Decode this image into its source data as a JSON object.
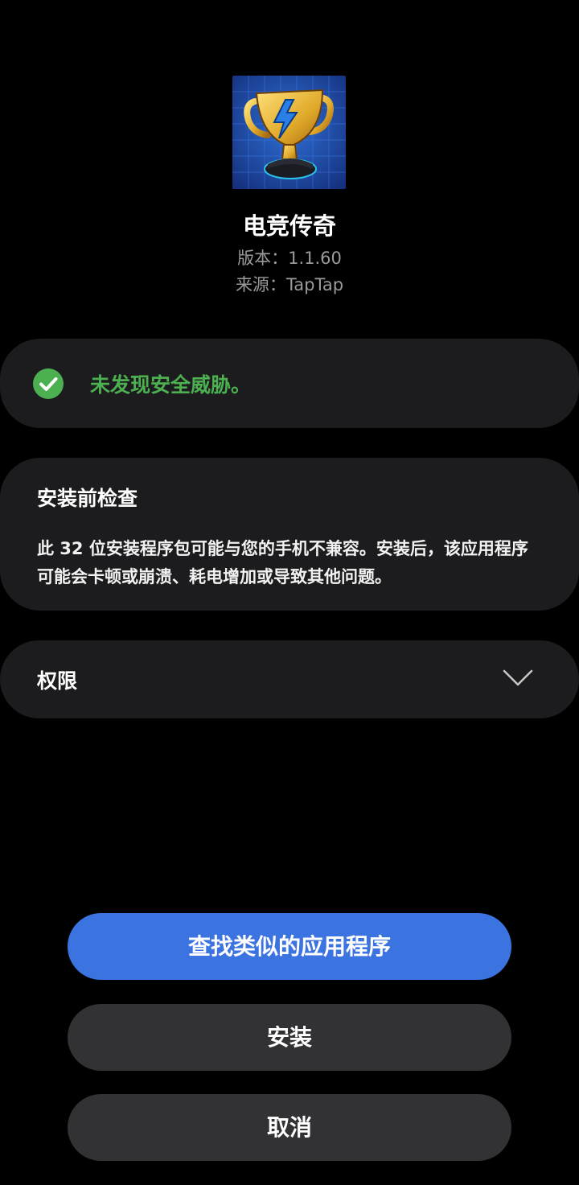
{
  "app": {
    "name": "电竞传奇",
    "version": "版本：1.1.60",
    "source": "来源：TapTap",
    "icon": "trophy-lightning-icon"
  },
  "security": {
    "message": "未发现安全威胁。",
    "icon": "check-circle-icon",
    "color": "#4caf50"
  },
  "precheck": {
    "title": "安装前检查",
    "body": "此 32 位安装程序包可能与您的手机不兼容。安装后，该应用程序可能会卡顿或崩溃、耗电增加或导致其他问题。"
  },
  "permissions": {
    "label": "权限",
    "icon": "chevron-down-icon"
  },
  "actions": {
    "find_similar": "查找类似的应用程序",
    "install": "安装",
    "cancel": "取消"
  },
  "colors": {
    "background": "#000000",
    "card": "#1c1c1e",
    "primary": "#3b73e0",
    "secondary_button": "#323234"
  }
}
